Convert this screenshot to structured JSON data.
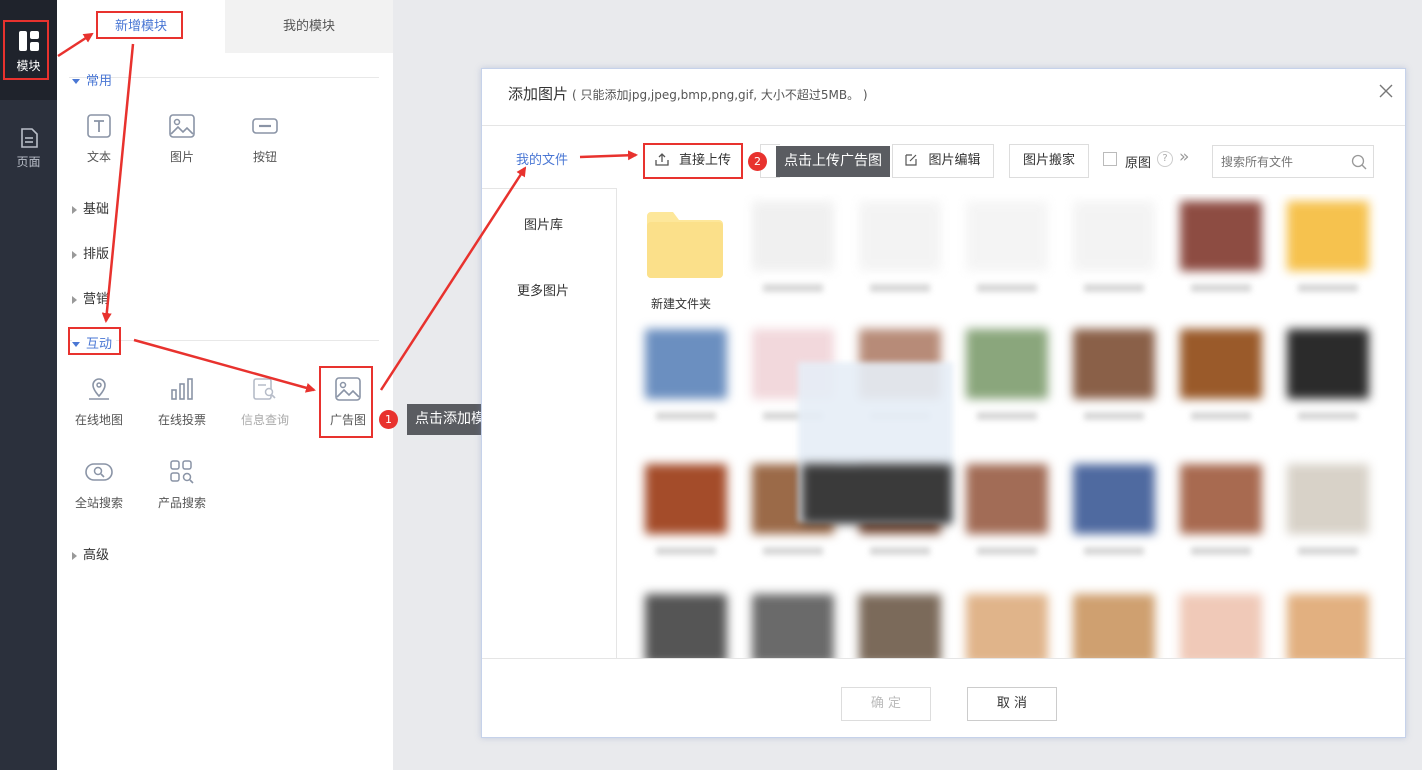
{
  "rail": {
    "items": [
      {
        "label": "模块",
        "icon": "layout-icon"
      },
      {
        "label": "页面",
        "icon": "page-icon"
      }
    ]
  },
  "panel": {
    "tabs": [
      "新增模块",
      "我的模块"
    ],
    "sections": {
      "common": {
        "title": "常用",
        "modules": [
          "文本",
          "图片",
          "按钮"
        ]
      },
      "basic": {
        "title": "基础"
      },
      "layout": {
        "title": "排版"
      },
      "marketing": {
        "title": "营销"
      },
      "interactive": {
        "title": "互动",
        "modules": [
          "在线地图",
          "在线投票",
          "信息查询",
          "广告图",
          "全站搜索",
          "产品搜索"
        ]
      },
      "advanced": {
        "title": "高级"
      }
    }
  },
  "annotations": {
    "step1": {
      "num": "1",
      "text": "点击添加模块"
    },
    "step2": {
      "num": "2",
      "text": "点击上传广告图"
    }
  },
  "dialog": {
    "title": "添加图片",
    "subtitle": "( 只能添加jpg,jpeg,bmp,png,gif, 大小不超过5MB。 )",
    "nav": [
      "我的文件",
      "图片库",
      "更多图片"
    ],
    "toolbar": {
      "upload": "直接上传",
      "edit": "图片编辑",
      "move": "图片搬家",
      "original": "原图",
      "help": "?",
      "more": "»",
      "search_placeholder": "搜索所有文件"
    },
    "folder_label": "新建文件夹",
    "confirm": "确 定",
    "cancel": "取 消"
  }
}
